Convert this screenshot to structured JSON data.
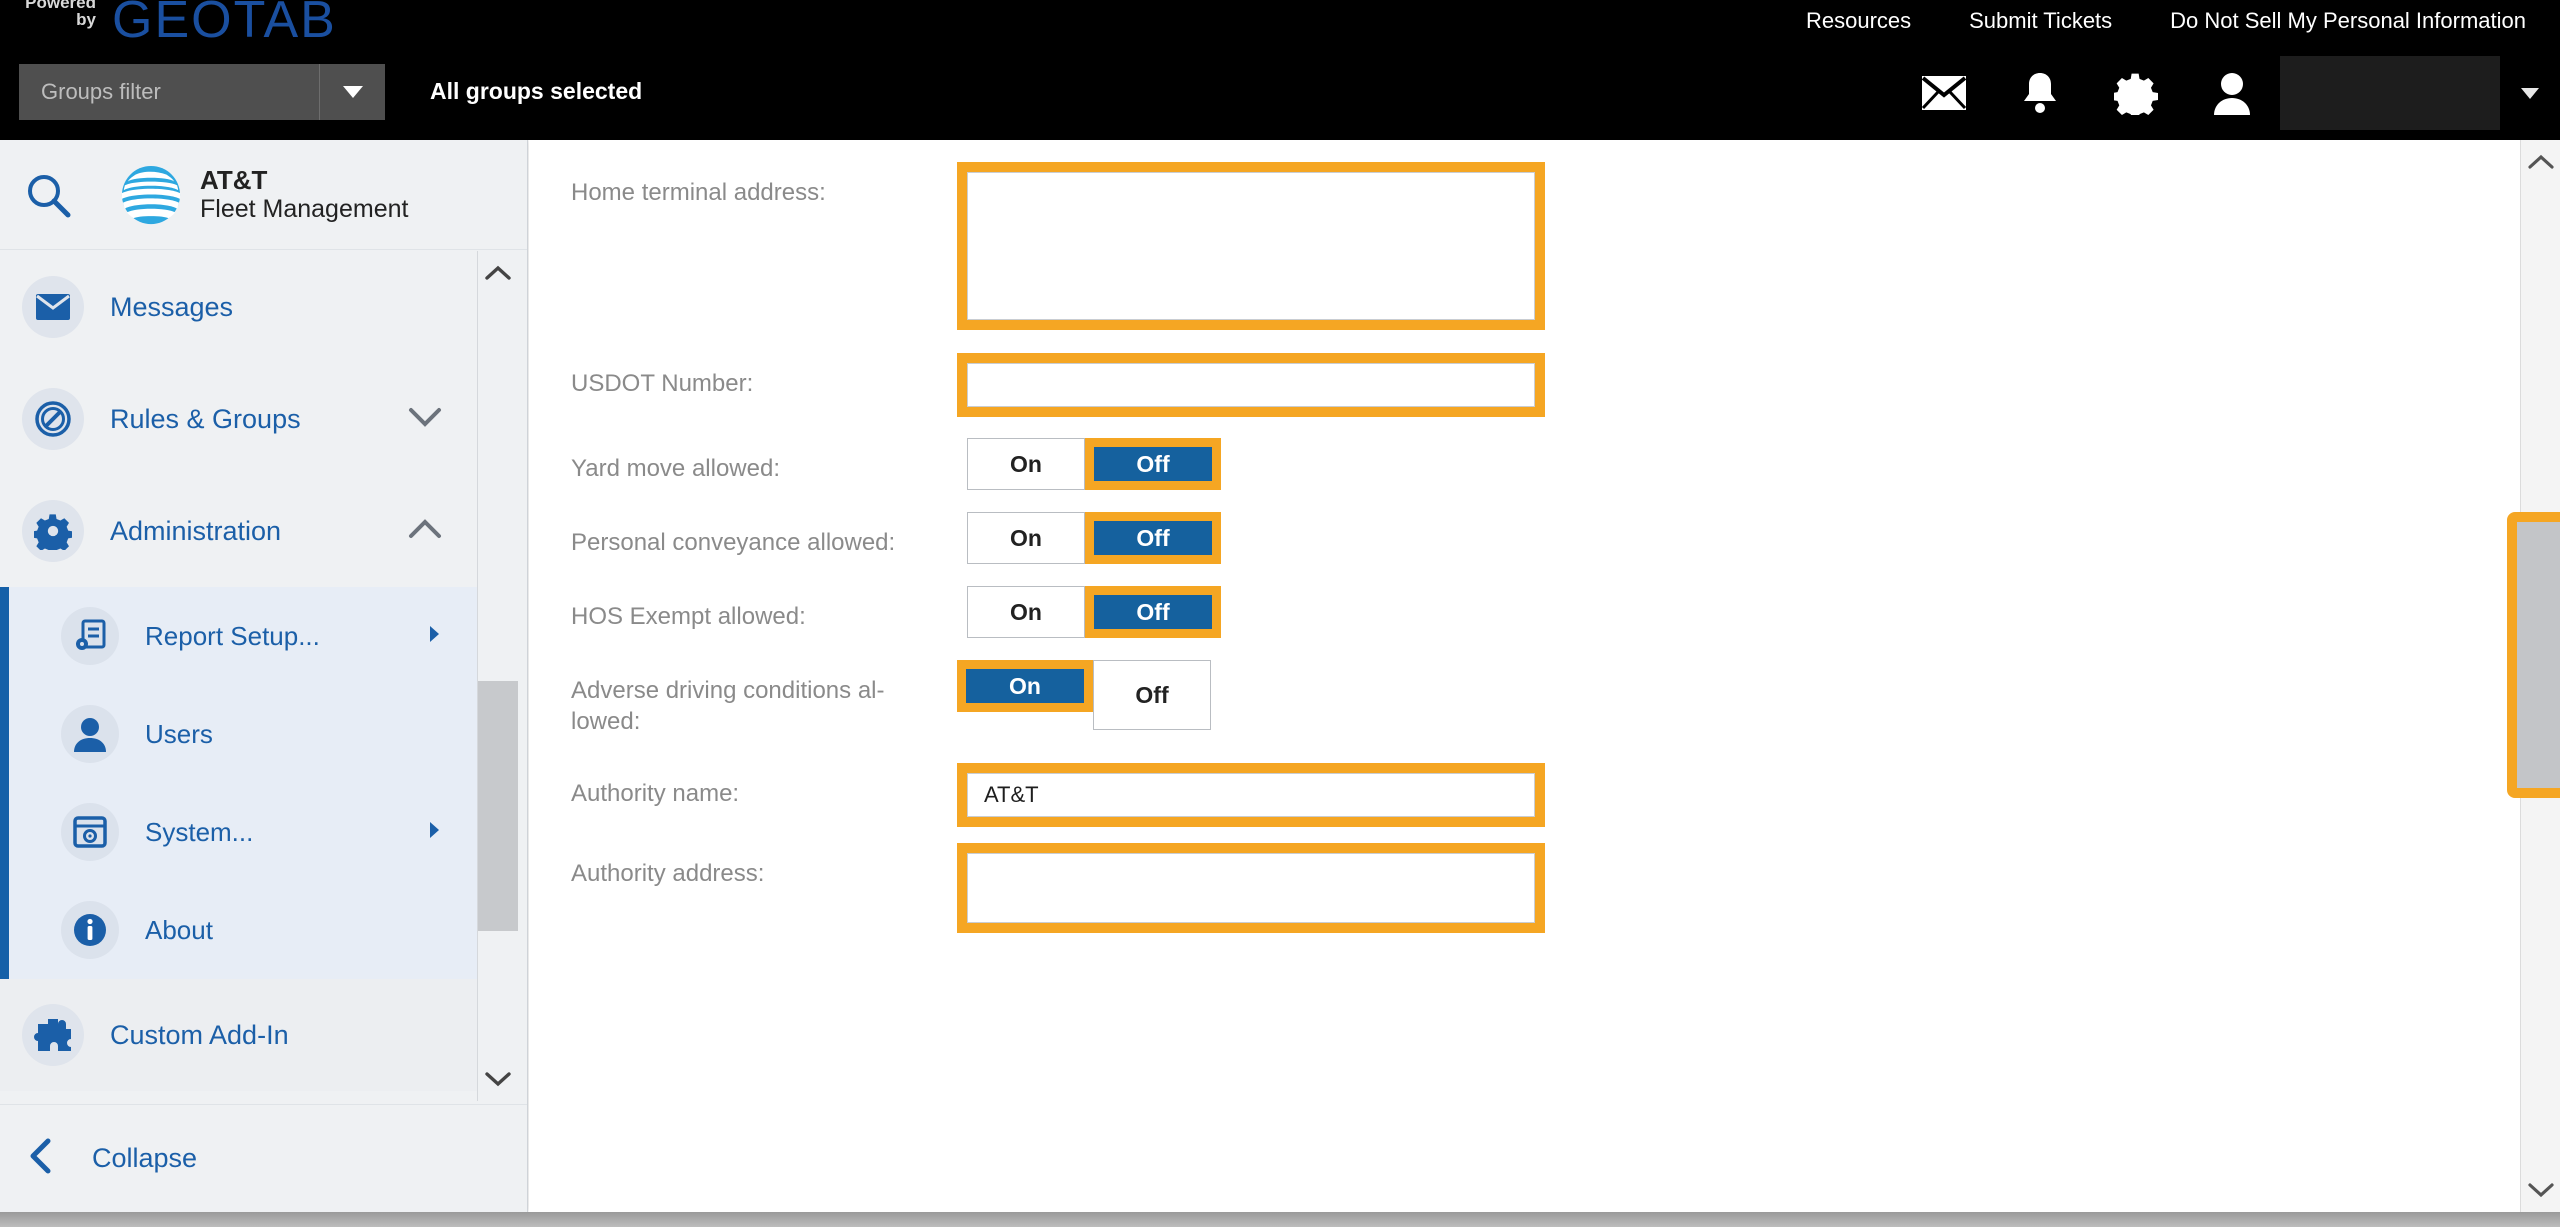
{
  "topbar": {
    "powered_line1": "Powered",
    "powered_line2": "by",
    "brand": "GEOTAB",
    "links": [
      {
        "label": "Resources",
        "name": "resources-link"
      },
      {
        "label": "Submit Tickets",
        "name": "submit-tickets-link"
      },
      {
        "label": "Do Not Sell My Personal Information",
        "name": "do-not-sell-link"
      }
    ],
    "groups_filter_placeholder": "Groups filter",
    "groups_selected_text": "All groups selected",
    "icons": [
      "mail-icon",
      "bell-icon",
      "gear-icon",
      "user-icon"
    ],
    "user_name_redacted": ""
  },
  "sidebar": {
    "product_name_line1": "AT&T",
    "product_name_line2": "Fleet Management",
    "search_icon": "search-icon",
    "items": [
      {
        "label": "Messages",
        "icon": "mail-icon",
        "chevron": ""
      },
      {
        "label": "Rules & Groups",
        "icon": "ban-circle-icon",
        "chevron": "down"
      },
      {
        "label": "Administration",
        "icon": "gear-icon",
        "chevron": "up"
      }
    ],
    "sub_items": [
      {
        "label": "Report Setup...",
        "icon": "report-setup-icon",
        "chevron": "right"
      },
      {
        "label": "Users",
        "icon": "user-icon",
        "chevron": ""
      },
      {
        "label": "System...",
        "icon": "system-icon",
        "chevron": "right"
      },
      {
        "label": "About",
        "icon": "info-icon",
        "chevron": ""
      }
    ],
    "addin": {
      "label": "Custom Add-In",
      "icon": "puzzle-icon"
    },
    "collapse_label": "Collapse"
  },
  "form": {
    "home_terminal_address": {
      "label": "Home terminal address:",
      "value": ""
    },
    "usdot_number": {
      "label": "USDOT Number:",
      "value": ""
    },
    "yard_move": {
      "label": "Yard move allowed:",
      "on_label": "On",
      "off_label": "Off",
      "selected": "Off"
    },
    "personal_conveyance": {
      "label": "Personal conveyance allowed:",
      "on_label": "On",
      "off_label": "Off",
      "selected": "Off"
    },
    "hos_exempt": {
      "label": "HOS Exempt allowed:",
      "on_label": "On",
      "off_label": "Off",
      "selected": "Off"
    },
    "adverse_driving": {
      "label": "Adverse driving conditions al-\nlowed:",
      "on_label": "On",
      "off_label": "Off",
      "selected": "On"
    },
    "authority_name": {
      "label": "Authority name:",
      "value": "AT&T"
    },
    "authority_address": {
      "label": "Authority address:",
      "value": ""
    }
  },
  "colors": {
    "highlight_orange": "#F5A623",
    "toggle_blue": "#15619e",
    "brand_blue": "#1b5fa8",
    "geotab_blue": "#1a4fa0",
    "att_cyan": "#2ea8e0"
  }
}
